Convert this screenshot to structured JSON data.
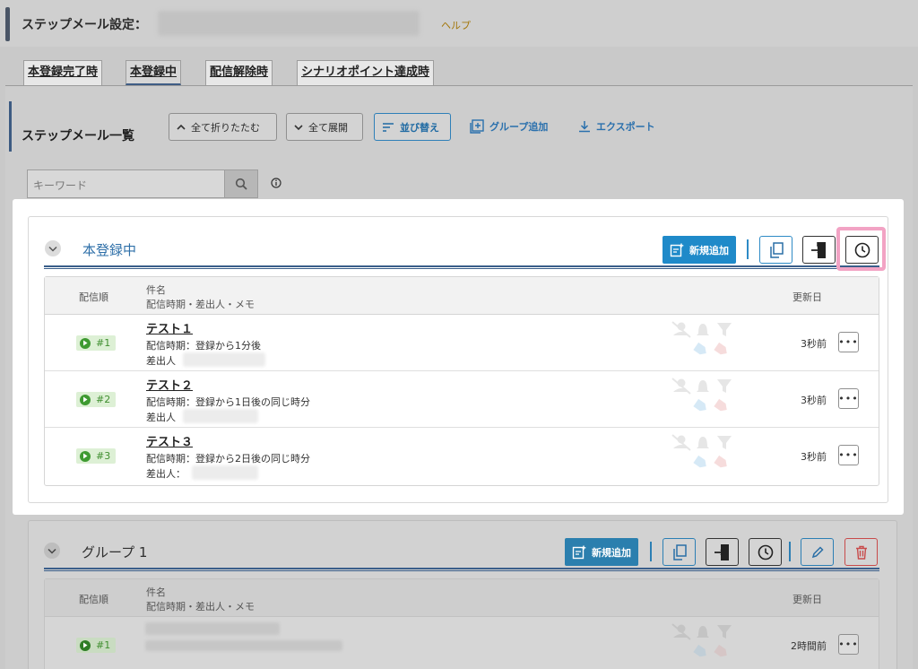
{
  "header": {
    "title": "ステップメール設定：",
    "help": "ヘルプ"
  },
  "tabs": [
    {
      "label": "本登録完了時",
      "active": false
    },
    {
      "label": "本登録中",
      "active": true
    },
    {
      "label": "配信解除時",
      "active": false
    },
    {
      "label": "シナリオポイント達成時",
      "active": false
    }
  ],
  "list": {
    "title": "ステップメール一覧",
    "collapse_all": "全て折りたたむ",
    "expand_all": "全て展開",
    "sort": "並び替え",
    "add_group": "グループ追加",
    "export": "エクスポート",
    "search_placeholder": "キーワード"
  },
  "group1": {
    "title": "本登録中",
    "new_label": "新規追加",
    "columns": {
      "order": "配信順",
      "subject": "件名",
      "subject_sub": "配信時期・差出人・メモ",
      "updated": "更新日"
    },
    "rows": [
      {
        "num": "#1",
        "subject": "テスト１",
        "timing": "配信時期：登録から1分後",
        "sender": "差出人",
        "updated": "3秒前"
      },
      {
        "num": "#2",
        "subject": "テスト２",
        "timing": "配信時期：登録から1日後の同じ時分",
        "sender": "差出人",
        "updated": "3秒前"
      },
      {
        "num": "#3",
        "subject": "テスト３",
        "timing": "配信時期：登録から2日後の同じ時分",
        "sender": "差出人：",
        "updated": "3秒前"
      }
    ]
  },
  "group2": {
    "title": "グループ 1",
    "new_label": "新規追加",
    "columns": {
      "order": "配信順",
      "subject": "件名",
      "subject_sub": "配信時期・差出人・メモ",
      "updated": "更新日"
    },
    "rows": [
      {
        "num": "#1",
        "updated": "2時間前"
      }
    ]
  },
  "colors": {
    "accent_blue": "#1f8ac9",
    "highlight_pink": "#f2a3c4",
    "status_green": "#3e9a31"
  }
}
